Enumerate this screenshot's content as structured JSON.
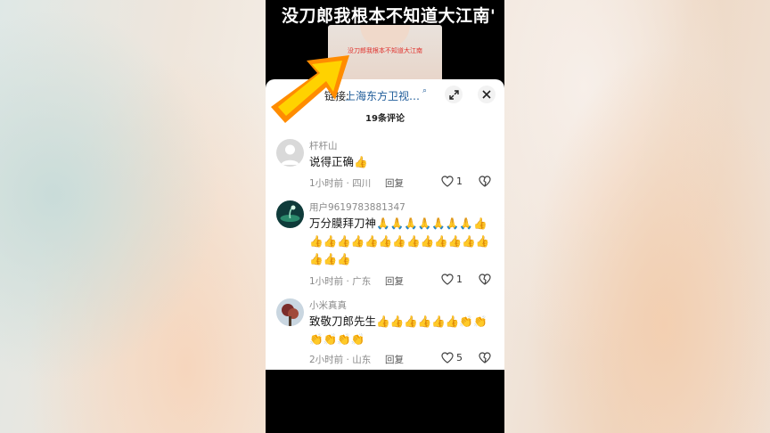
{
  "video": {
    "title": "没刀郎我根本不知道大江南",
    "title_tail": "'",
    "caption": "没刀郎我根本不知道大江南"
  },
  "comments_panel": {
    "link_label": "链接:",
    "link_text": "上海东方卫视…",
    "count_title": "19条评论",
    "comments": [
      {
        "username": "杆杆山",
        "text": "说得正确👍",
        "time": "1小时前",
        "region": "四川",
        "reply_label": "回复",
        "likes": "1"
      },
      {
        "username": "用户9619783881347",
        "text": "万分膜拜刀神🙏🙏🙏🙏🙏🙏🙏👍👍👍👍👍👍👍👍👍👍👍👍👍👍👍👍👍",
        "time": "1小时前",
        "region": "广东",
        "reply_label": "回复",
        "likes": "1"
      },
      {
        "username": "小米真真",
        "text": "致敬刀郎先生👍👍👍👍👍👍👏👏👏👏👏👏",
        "time": "2小时前",
        "region": "山东",
        "reply_label": "回复",
        "likes": "5"
      }
    ]
  },
  "colors": {
    "link": "#1f5c99",
    "arrow_outer": "#ff8c00",
    "arrow_inner": "#ffd200"
  }
}
